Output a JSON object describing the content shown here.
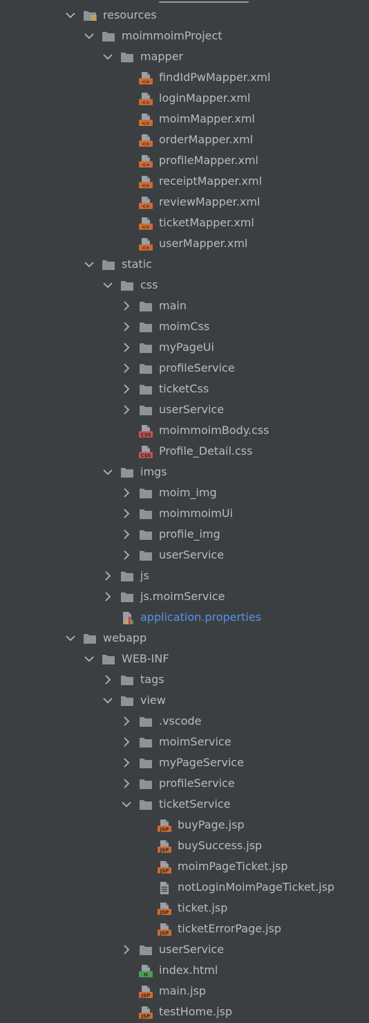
{
  "tree": [
    {
      "label": "resources",
      "depth": 0,
      "kind": "folder-res",
      "state": "open"
    },
    {
      "label": "moimmoimProject",
      "depth": 1,
      "kind": "folder",
      "state": "open"
    },
    {
      "label": "mapper",
      "depth": 2,
      "kind": "folder",
      "state": "open"
    },
    {
      "label": "findIdPwMapper.xml",
      "depth": 3,
      "kind": "xml",
      "state": "leaf"
    },
    {
      "label": "loginMapper.xml",
      "depth": 3,
      "kind": "xml",
      "state": "leaf"
    },
    {
      "label": "moimMapper.xml",
      "depth": 3,
      "kind": "xml",
      "state": "leaf"
    },
    {
      "label": "orderMapper.xml",
      "depth": 3,
      "kind": "xml",
      "state": "leaf"
    },
    {
      "label": "profileMapper.xml",
      "depth": 3,
      "kind": "xml",
      "state": "leaf"
    },
    {
      "label": "receiptMapper.xml",
      "depth": 3,
      "kind": "xml",
      "state": "leaf"
    },
    {
      "label": "reviewMapper.xml",
      "depth": 3,
      "kind": "xml",
      "state": "leaf"
    },
    {
      "label": "ticketMapper.xml",
      "depth": 3,
      "kind": "xml",
      "state": "leaf"
    },
    {
      "label": "userMapper.xml",
      "depth": 3,
      "kind": "xml",
      "state": "leaf"
    },
    {
      "label": "static",
      "depth": 1,
      "kind": "folder",
      "state": "open"
    },
    {
      "label": "css",
      "depth": 2,
      "kind": "folder",
      "state": "open"
    },
    {
      "label": "main",
      "depth": 3,
      "kind": "folder",
      "state": "closed"
    },
    {
      "label": "moimCss",
      "depth": 3,
      "kind": "folder",
      "state": "closed"
    },
    {
      "label": "myPageUi",
      "depth": 3,
      "kind": "folder",
      "state": "closed"
    },
    {
      "label": "profileService",
      "depth": 3,
      "kind": "folder",
      "state": "closed"
    },
    {
      "label": "ticketCss",
      "depth": 3,
      "kind": "folder",
      "state": "closed"
    },
    {
      "label": "userService",
      "depth": 3,
      "kind": "folder",
      "state": "closed"
    },
    {
      "label": "moimmoimBody.css",
      "depth": 3,
      "kind": "css",
      "state": "leaf"
    },
    {
      "label": "Profile_Detail.css",
      "depth": 3,
      "kind": "css",
      "state": "leaf"
    },
    {
      "label": "imgs",
      "depth": 2,
      "kind": "folder",
      "state": "open"
    },
    {
      "label": "moim_img",
      "depth": 3,
      "kind": "folder",
      "state": "closed"
    },
    {
      "label": "moimmoimUi",
      "depth": 3,
      "kind": "folder",
      "state": "closed"
    },
    {
      "label": "profile_img",
      "depth": 3,
      "kind": "folder",
      "state": "closed"
    },
    {
      "label": "userService",
      "depth": 3,
      "kind": "folder",
      "state": "closed"
    },
    {
      "label": "js",
      "depth": 2,
      "kind": "folder",
      "state": "closed"
    },
    {
      "label": "js.moimService",
      "depth": 2,
      "kind": "folder",
      "state": "closed"
    },
    {
      "label": "application.properties",
      "depth": 2,
      "kind": "props",
      "state": "leaf"
    },
    {
      "label": "webapp",
      "depth": 0,
      "kind": "folder",
      "state": "open"
    },
    {
      "label": "WEB-INF",
      "depth": 1,
      "kind": "folder",
      "state": "open"
    },
    {
      "label": "tags",
      "depth": 2,
      "kind": "folder",
      "state": "closed"
    },
    {
      "label": "view",
      "depth": 2,
      "kind": "folder",
      "state": "open"
    },
    {
      "label": ".vscode",
      "depth": 3,
      "kind": "folder",
      "state": "closed"
    },
    {
      "label": "moimService",
      "depth": 3,
      "kind": "folder",
      "state": "closed"
    },
    {
      "label": "myPageService",
      "depth": 3,
      "kind": "folder",
      "state": "closed"
    },
    {
      "label": "profileService",
      "depth": 3,
      "kind": "folder",
      "state": "closed"
    },
    {
      "label": "ticketService",
      "depth": 3,
      "kind": "folder",
      "state": "open"
    },
    {
      "label": "buyPage.jsp",
      "depth": 4,
      "kind": "jsp",
      "state": "leaf"
    },
    {
      "label": "buySuccess.jsp",
      "depth": 4,
      "kind": "jsp",
      "state": "leaf"
    },
    {
      "label": "moimPageTicket.jsp",
      "depth": 4,
      "kind": "jsp",
      "state": "leaf"
    },
    {
      "label": "notLoginMoimPageTicket.jsp",
      "depth": 4,
      "kind": "text",
      "state": "leaf"
    },
    {
      "label": "ticket.jsp",
      "depth": 4,
      "kind": "jsp",
      "state": "leaf"
    },
    {
      "label": "ticketErrorPage.jsp",
      "depth": 4,
      "kind": "jsp",
      "state": "leaf"
    },
    {
      "label": "userService",
      "depth": 3,
      "kind": "folder",
      "state": "closed"
    },
    {
      "label": "index.html",
      "depth": 3,
      "kind": "html",
      "state": "leaf"
    },
    {
      "label": "main.jsp",
      "depth": 3,
      "kind": "jsp",
      "state": "leaf"
    },
    {
      "label": "testHome.jsp",
      "depth": 3,
      "kind": "jsp",
      "state": "leaf"
    }
  ],
  "colors": {
    "background": "#3c3f41",
    "text": "#bbbbbb",
    "link_text": "#5394ec",
    "folder": "#8d9399",
    "xml_badge": "#cc6a31",
    "css_badge": "#c75450",
    "jsp_badge": "#cc6a31",
    "html_badge": "#499c54"
  }
}
